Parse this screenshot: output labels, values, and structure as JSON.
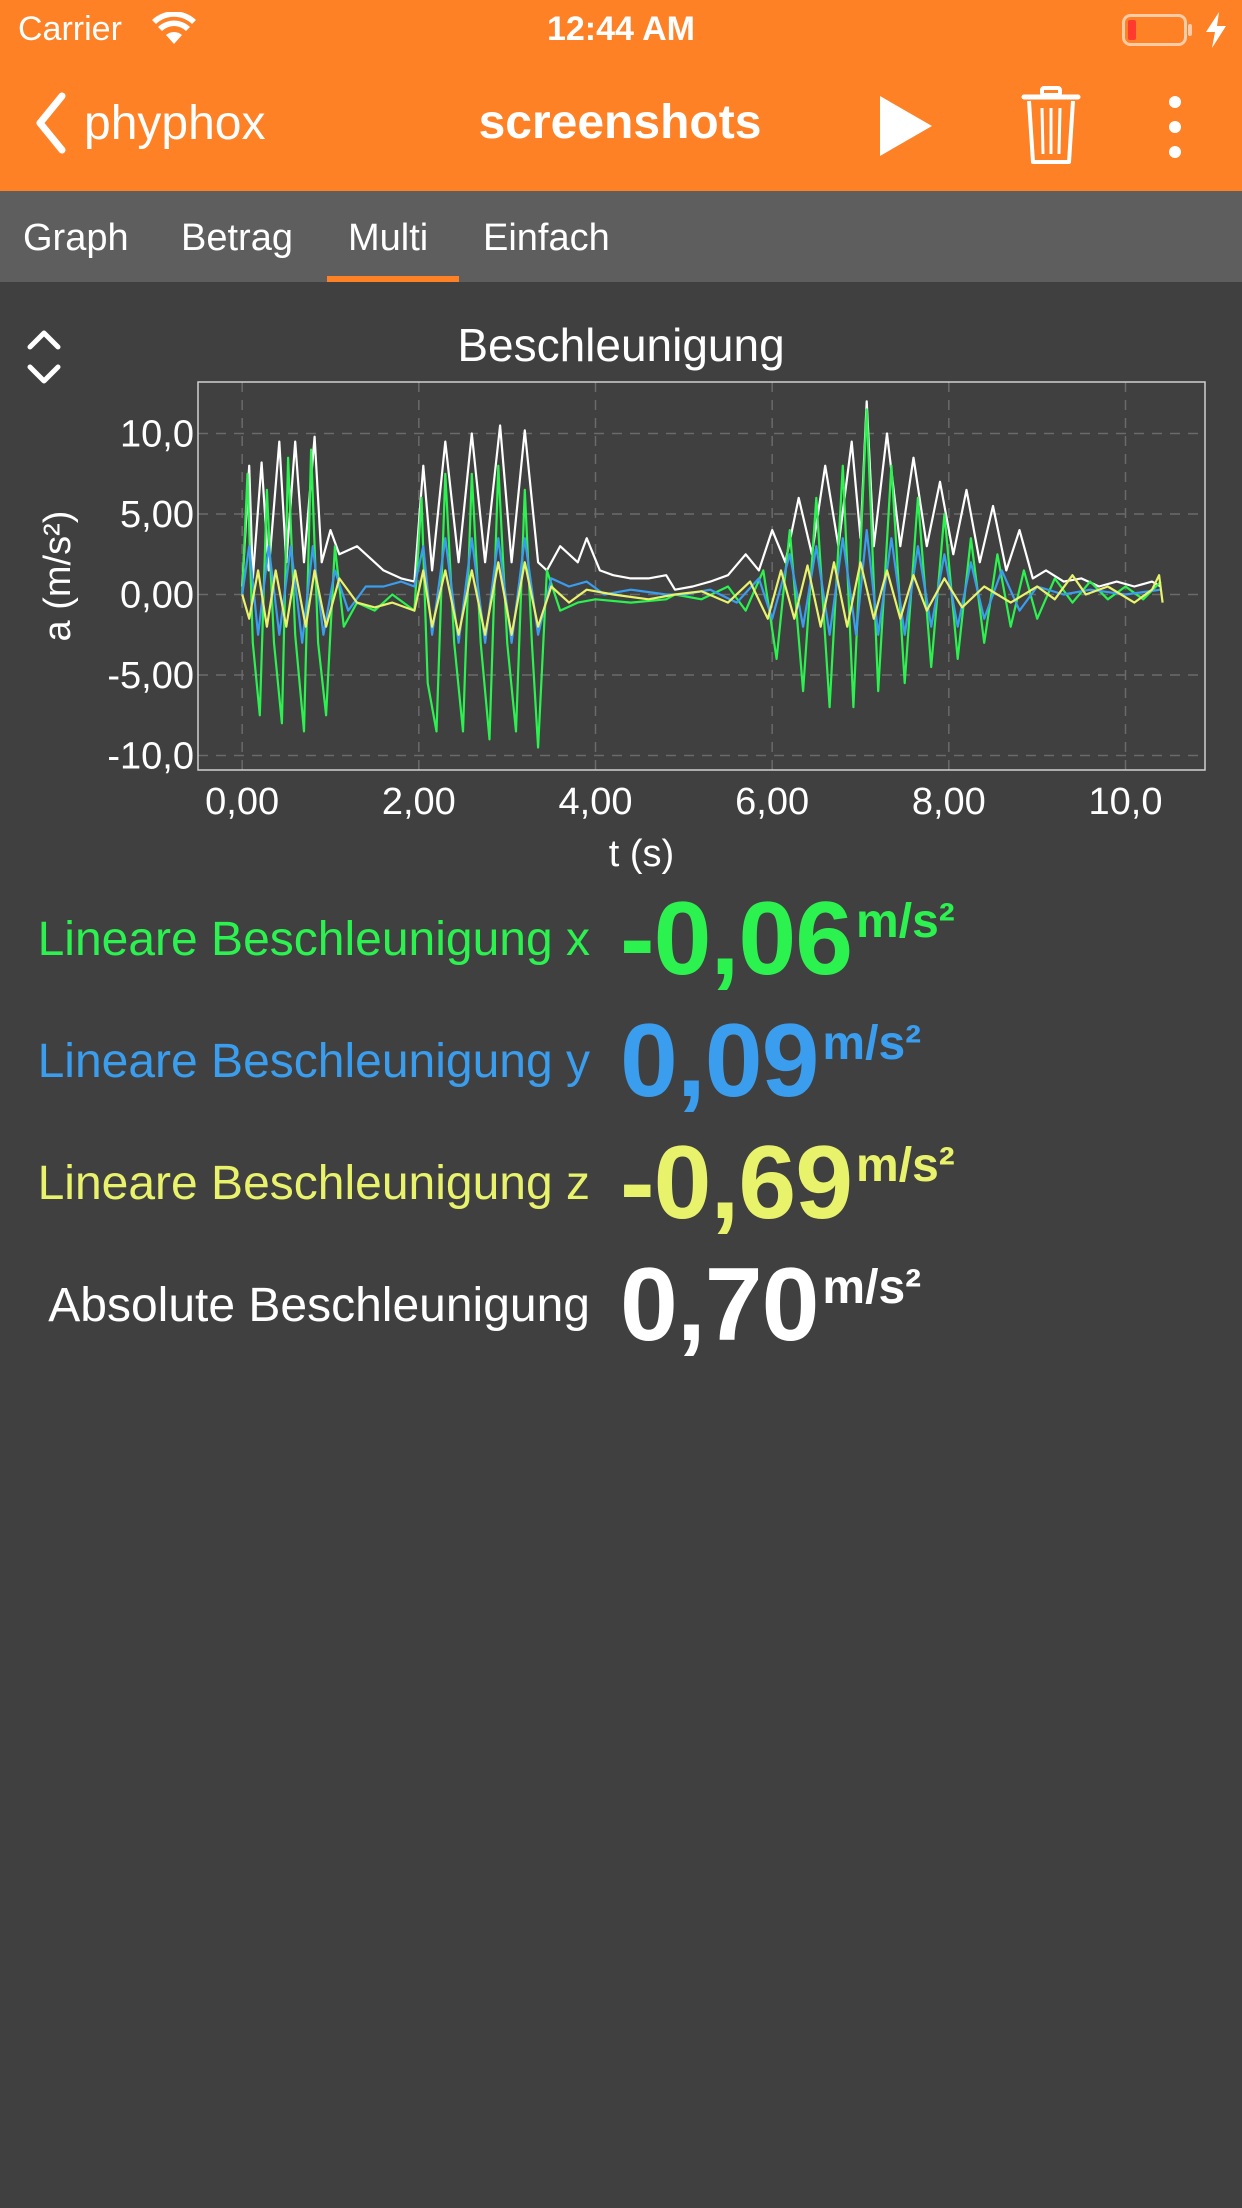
{
  "status_bar": {
    "carrier": "Carrier",
    "time": "12:44 AM"
  },
  "nav": {
    "back_label": "phyphox",
    "title": "screenshots"
  },
  "tabs": [
    {
      "label": "Graph"
    },
    {
      "label": "Betrag"
    },
    {
      "label": "Multi",
      "active": true
    },
    {
      "label": "Einfach"
    }
  ],
  "colors": {
    "accent": "#fe8125",
    "background": "#404040",
    "tab_bar": "#5e5e5e",
    "x": "#2bf24f",
    "y": "#3a9dee",
    "z": "#e9f26b",
    "abs": "#ffffff"
  },
  "chart_data": {
    "type": "line",
    "title": "Beschleunigung",
    "xlabel": "t (s)",
    "ylabel": "a (m/s²)",
    "xlim": [
      -0.5,
      10.9
    ],
    "ylim": [
      -10.9,
      13.2
    ],
    "xticks": [
      "0,00",
      "2,00",
      "4,00",
      "6,00",
      "8,00",
      "10,0"
    ],
    "xtick_values": [
      0,
      2,
      4,
      6,
      8,
      10
    ],
    "yticks": [
      "10,0",
      "5,00",
      "0,00",
      "-5,00",
      "-10,0"
    ],
    "ytick_values": [
      10,
      5,
      0,
      -5,
      -10
    ],
    "grid": true,
    "series": [
      {
        "name": "Absolute Beschleunigung",
        "color": "#ffffff",
        "points": [
          [
            0.0,
            0.5
          ],
          [
            0.08,
            8.0
          ],
          [
            0.12,
            1.0
          ],
          [
            0.22,
            8.2
          ],
          [
            0.3,
            1.5
          ],
          [
            0.42,
            9.5
          ],
          [
            0.5,
            2.0
          ],
          [
            0.6,
            9.5
          ],
          [
            0.7,
            2.0
          ],
          [
            0.82,
            9.8
          ],
          [
            0.9,
            2.0
          ],
          [
            1.0,
            4.0
          ],
          [
            1.1,
            2.5
          ],
          [
            1.3,
            3.0
          ],
          [
            1.5,
            2.0
          ],
          [
            1.6,
            1.5
          ],
          [
            1.8,
            1.0
          ],
          [
            1.95,
            0.8
          ],
          [
            2.05,
            8.0
          ],
          [
            2.15,
            1.5
          ],
          [
            2.3,
            9.5
          ],
          [
            2.45,
            2.0
          ],
          [
            2.6,
            10.0
          ],
          [
            2.75,
            2.0
          ],
          [
            2.92,
            10.5
          ],
          [
            3.05,
            2.0
          ],
          [
            3.2,
            10.2
          ],
          [
            3.35,
            2.0
          ],
          [
            3.45,
            1.5
          ],
          [
            3.6,
            3.0
          ],
          [
            3.8,
            2.0
          ],
          [
            3.9,
            3.5
          ],
          [
            4.05,
            1.5
          ],
          [
            4.2,
            1.2
          ],
          [
            4.4,
            1.0
          ],
          [
            4.6,
            1.0
          ],
          [
            4.8,
            1.2
          ],
          [
            4.9,
            0.3
          ],
          [
            5.1,
            0.5
          ],
          [
            5.3,
            0.8
          ],
          [
            5.5,
            1.2
          ],
          [
            5.7,
            2.5
          ],
          [
            5.85,
            1.5
          ],
          [
            6.0,
            4.0
          ],
          [
            6.15,
            2.0
          ],
          [
            6.3,
            6.0
          ],
          [
            6.45,
            2.5
          ],
          [
            6.6,
            8.0
          ],
          [
            6.75,
            3.0
          ],
          [
            6.9,
            9.5
          ],
          [
            7.0,
            3.5
          ],
          [
            7.07,
            12.0
          ],
          [
            7.15,
            3.0
          ],
          [
            7.3,
            10.0
          ],
          [
            7.45,
            3.0
          ],
          [
            7.6,
            8.5
          ],
          [
            7.75,
            3.0
          ],
          [
            7.9,
            7.0
          ],
          [
            8.05,
            2.5
          ],
          [
            8.2,
            6.5
          ],
          [
            8.35,
            2.0
          ],
          [
            8.5,
            5.5
          ],
          [
            8.65,
            1.5
          ],
          [
            8.8,
            4.0
          ],
          [
            8.95,
            1.0
          ],
          [
            9.1,
            1.5
          ],
          [
            9.3,
            0.8
          ],
          [
            9.5,
            1.0
          ],
          [
            9.7,
            0.5
          ],
          [
            9.9,
            0.8
          ],
          [
            10.1,
            0.5
          ],
          [
            10.3,
            0.8
          ],
          [
            10.4,
            0.5
          ]
        ]
      },
      {
        "name": "Lineare Beschleunigung x",
        "color": "#2bf24f",
        "points": [
          [
            0.0,
            0.0
          ],
          [
            0.06,
            7.5
          ],
          [
            0.12,
            -3.0
          ],
          [
            0.2,
            -7.5
          ],
          [
            0.28,
            6.5
          ],
          [
            0.36,
            -3.0
          ],
          [
            0.45,
            -8.0
          ],
          [
            0.52,
            8.5
          ],
          [
            0.6,
            -2.5
          ],
          [
            0.7,
            -8.5
          ],
          [
            0.78,
            9.0
          ],
          [
            0.86,
            -3.0
          ],
          [
            0.95,
            -7.5
          ],
          [
            1.05,
            3.0
          ],
          [
            1.15,
            -2.0
          ],
          [
            1.3,
            -0.5
          ],
          [
            1.5,
            -1.0
          ],
          [
            1.7,
            0.0
          ],
          [
            1.95,
            -1.0
          ],
          [
            2.03,
            6.0
          ],
          [
            2.1,
            -5.5
          ],
          [
            2.2,
            -8.5
          ],
          [
            2.3,
            7.5
          ],
          [
            2.4,
            -3.0
          ],
          [
            2.5,
            -8.5
          ],
          [
            2.6,
            7.5
          ],
          [
            2.7,
            -3.0
          ],
          [
            2.8,
            -9.0
          ],
          [
            2.9,
            8.0
          ],
          [
            3.0,
            -3.0
          ],
          [
            3.1,
            -8.5
          ],
          [
            3.2,
            6.5
          ],
          [
            3.28,
            -3.0
          ],
          [
            3.35,
            -9.5
          ],
          [
            3.45,
            1.5
          ],
          [
            3.6,
            -1.0
          ],
          [
            3.8,
            -0.5
          ],
          [
            4.0,
            -0.3
          ],
          [
            4.4,
            -0.5
          ],
          [
            4.8,
            -0.3
          ],
          [
            4.9,
            0.0
          ],
          [
            5.2,
            -0.3
          ],
          [
            5.5,
            0.5
          ],
          [
            5.7,
            -1.0
          ],
          [
            5.9,
            1.5
          ],
          [
            6.05,
            -4.0
          ],
          [
            6.2,
            4.0
          ],
          [
            6.35,
            -6.0
          ],
          [
            6.5,
            6.0
          ],
          [
            6.65,
            -7.0
          ],
          [
            6.8,
            8.0
          ],
          [
            6.92,
            -7.0
          ],
          [
            7.07,
            11.5
          ],
          [
            7.2,
            -6.0
          ],
          [
            7.35,
            8.0
          ],
          [
            7.5,
            -5.5
          ],
          [
            7.65,
            6.0
          ],
          [
            7.8,
            -4.5
          ],
          [
            7.95,
            5.0
          ],
          [
            8.1,
            -4.0
          ],
          [
            8.25,
            3.5
          ],
          [
            8.4,
            -3.0
          ],
          [
            8.55,
            2.5
          ],
          [
            8.7,
            -2.0
          ],
          [
            8.85,
            1.5
          ],
          [
            9.0,
            -1.5
          ],
          [
            9.2,
            1.0
          ],
          [
            9.4,
            -0.5
          ],
          [
            9.6,
            0.8
          ],
          [
            9.8,
            -0.3
          ],
          [
            10.0,
            0.5
          ],
          [
            10.2,
            -0.3
          ],
          [
            10.4,
            0.8
          ]
        ]
      },
      {
        "name": "Lineare Beschleunigung y",
        "color": "#3a9dee",
        "points": [
          [
            0.0,
            0.0
          ],
          [
            0.08,
            3.0
          ],
          [
            0.18,
            -2.5
          ],
          [
            0.3,
            3.0
          ],
          [
            0.42,
            -2.5
          ],
          [
            0.55,
            3.0
          ],
          [
            0.68,
            -3.0
          ],
          [
            0.8,
            3.0
          ],
          [
            0.92,
            -2.5
          ],
          [
            1.05,
            1.5
          ],
          [
            1.2,
            -1.0
          ],
          [
            1.4,
            0.5
          ],
          [
            1.6,
            0.5
          ],
          [
            1.8,
            0.8
          ],
          [
            1.95,
            0.5
          ],
          [
            2.05,
            3.0
          ],
          [
            2.15,
            -2.5
          ],
          [
            2.3,
            3.5
          ],
          [
            2.45,
            -3.0
          ],
          [
            2.6,
            3.5
          ],
          [
            2.75,
            -3.0
          ],
          [
            2.9,
            3.5
          ],
          [
            3.05,
            -3.0
          ],
          [
            3.2,
            3.5
          ],
          [
            3.35,
            -2.5
          ],
          [
            3.5,
            1.0
          ],
          [
            3.7,
            0.5
          ],
          [
            3.9,
            0.8
          ],
          [
            4.1,
            0.0
          ],
          [
            4.4,
            0.3
          ],
          [
            4.8,
            0.0
          ],
          [
            5.0,
            0.0
          ],
          [
            5.3,
            0.3
          ],
          [
            5.6,
            -0.5
          ],
          [
            5.85,
            1.0
          ],
          [
            6.0,
            -1.5
          ],
          [
            6.2,
            2.5
          ],
          [
            6.35,
            -2.0
          ],
          [
            6.5,
            3.0
          ],
          [
            6.65,
            -2.5
          ],
          [
            6.8,
            3.5
          ],
          [
            6.95,
            -2.5
          ],
          [
            7.07,
            4.0
          ],
          [
            7.2,
            -2.5
          ],
          [
            7.35,
            3.5
          ],
          [
            7.5,
            -2.5
          ],
          [
            7.65,
            3.0
          ],
          [
            7.8,
            -2.0
          ],
          [
            7.95,
            2.5
          ],
          [
            8.1,
            -2.0
          ],
          [
            8.25,
            2.0
          ],
          [
            8.4,
            -1.5
          ],
          [
            8.6,
            1.5
          ],
          [
            8.8,
            -1.0
          ],
          [
            9.0,
            0.5
          ],
          [
            9.3,
            0.0
          ],
          [
            9.6,
            0.3
          ],
          [
            10.0,
            0.0
          ],
          [
            10.4,
            0.3
          ]
        ]
      },
      {
        "name": "Lineare Beschleunigung z",
        "color": "#e9f26b",
        "points": [
          [
            0.0,
            0.0
          ],
          [
            0.08,
            -1.5
          ],
          [
            0.18,
            1.5
          ],
          [
            0.28,
            -2.0
          ],
          [
            0.38,
            1.5
          ],
          [
            0.5,
            -2.0
          ],
          [
            0.6,
            1.5
          ],
          [
            0.72,
            -2.0
          ],
          [
            0.82,
            1.5
          ],
          [
            0.95,
            -2.0
          ],
          [
            1.1,
            1.0
          ],
          [
            1.3,
            -0.5
          ],
          [
            1.5,
            -0.8
          ],
          [
            1.7,
            -0.5
          ],
          [
            1.95,
            -1.0
          ],
          [
            2.05,
            1.5
          ],
          [
            2.15,
            -2.0
          ],
          [
            2.3,
            1.5
          ],
          [
            2.45,
            -2.5
          ],
          [
            2.6,
            1.5
          ],
          [
            2.75,
            -2.5
          ],
          [
            2.9,
            2.0
          ],
          [
            3.05,
            -2.5
          ],
          [
            3.2,
            2.0
          ],
          [
            3.35,
            -2.0
          ],
          [
            3.5,
            0.5
          ],
          [
            3.7,
            -0.5
          ],
          [
            3.9,
            0.3
          ],
          [
            4.2,
            0.0
          ],
          [
            4.6,
            -0.3
          ],
          [
            4.9,
            0.0
          ],
          [
            5.2,
            0.2
          ],
          [
            5.5,
            -0.5
          ],
          [
            5.75,
            0.8
          ],
          [
            5.95,
            -1.5
          ],
          [
            6.1,
            1.5
          ],
          [
            6.25,
            -1.5
          ],
          [
            6.4,
            1.8
          ],
          [
            6.55,
            -2.0
          ],
          [
            6.7,
            2.0
          ],
          [
            6.85,
            -2.0
          ],
          [
            7.0,
            2.0
          ],
          [
            7.15,
            -1.5
          ],
          [
            7.3,
            1.5
          ],
          [
            7.45,
            -1.5
          ],
          [
            7.6,
            1.2
          ],
          [
            7.75,
            -1.0
          ],
          [
            7.95,
            1.0
          ],
          [
            8.15,
            -0.8
          ],
          [
            8.4,
            0.5
          ],
          [
            8.7,
            -0.5
          ],
          [
            9.0,
            0.5
          ],
          [
            9.2,
            -0.3
          ],
          [
            9.4,
            1.2
          ],
          [
            9.55,
            0.0
          ],
          [
            9.8,
            0.5
          ],
          [
            10.1,
            -0.5
          ],
          [
            10.3,
            0.3
          ],
          [
            10.38,
            1.2
          ],
          [
            10.42,
            -0.5
          ]
        ]
      }
    ]
  },
  "values": [
    {
      "label": "Lineare Beschleunigung x",
      "value": "-0,06",
      "unit": "m/s²",
      "color": "#2bf24f"
    },
    {
      "label": "Lineare Beschleunigung y",
      "value": "0,09",
      "unit": "m/s²",
      "color": "#3a9dee"
    },
    {
      "label": "Lineare Beschleunigung z",
      "value": "-0,69",
      "unit": "m/s²",
      "color": "#e9f26b"
    },
    {
      "label": "Absolute Beschleunigung",
      "value": "0,70",
      "unit": "m/s²",
      "color": "#ffffff"
    }
  ]
}
